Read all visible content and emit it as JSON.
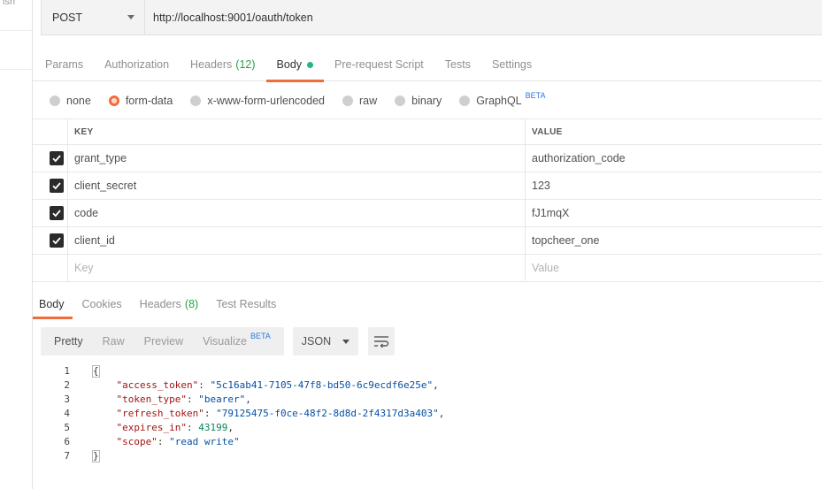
{
  "sidebar": {
    "stub_text": "ish"
  },
  "request": {
    "method": "POST",
    "url": "http://localhost:9001/oauth/token"
  },
  "request_tabs": [
    {
      "label": "Params"
    },
    {
      "label": "Authorization"
    },
    {
      "label": "Headers",
      "count": "(12)"
    },
    {
      "label": "Body"
    },
    {
      "label": "Pre-request Script"
    },
    {
      "label": "Tests"
    },
    {
      "label": "Settings"
    }
  ],
  "body_types": [
    {
      "label": "none"
    },
    {
      "label": "form-data"
    },
    {
      "label": "x-www-form-urlencoded"
    },
    {
      "label": "raw"
    },
    {
      "label": "binary"
    },
    {
      "label": "GraphQL",
      "badge": "BETA"
    }
  ],
  "params_table": {
    "headers": {
      "key": "KEY",
      "value": "VALUE"
    },
    "rows": [
      {
        "key": "grant_type",
        "value": "authorization_code"
      },
      {
        "key": "client_secret",
        "value": "123"
      },
      {
        "key": "code",
        "value": "fJ1mqX"
      },
      {
        "key": "client_id",
        "value": "topcheer_one"
      }
    ],
    "new_row": {
      "key_placeholder": "Key",
      "value_placeholder": "Value"
    }
  },
  "response_tabs": [
    {
      "label": "Body"
    },
    {
      "label": "Cookies"
    },
    {
      "label": "Headers",
      "count": "(8)"
    },
    {
      "label": "Test Results"
    }
  ],
  "response_toolbar": {
    "views": [
      "Pretty",
      "Raw",
      "Preview",
      "Visualize"
    ],
    "visualize_badge": "BETA",
    "language": "JSON"
  },
  "response_body": {
    "line_numbers": [
      "1",
      "2",
      "3",
      "4",
      "5",
      "6",
      "7"
    ],
    "open_brace": "{",
    "close_brace": "}",
    "entries": [
      {
        "key": "\"access_token\"",
        "value": "\"5c16ab41-7105-47f8-bd50-6c9ecdf6e25e\"",
        "type": "string"
      },
      {
        "key": "\"token_type\"",
        "value": "\"bearer\"",
        "type": "string"
      },
      {
        "key": "\"refresh_token\"",
        "value": "\"79125475-f0ce-48f2-8d8d-2f4317d3a403\"",
        "type": "string"
      },
      {
        "key": "\"expires_in\"",
        "value": "43199",
        "type": "number"
      },
      {
        "key": "\"scope\"",
        "value": "\"read write\"",
        "type": "string"
      }
    ]
  },
  "colors": {
    "accent": "#f26b3a",
    "green": "#24a148"
  }
}
